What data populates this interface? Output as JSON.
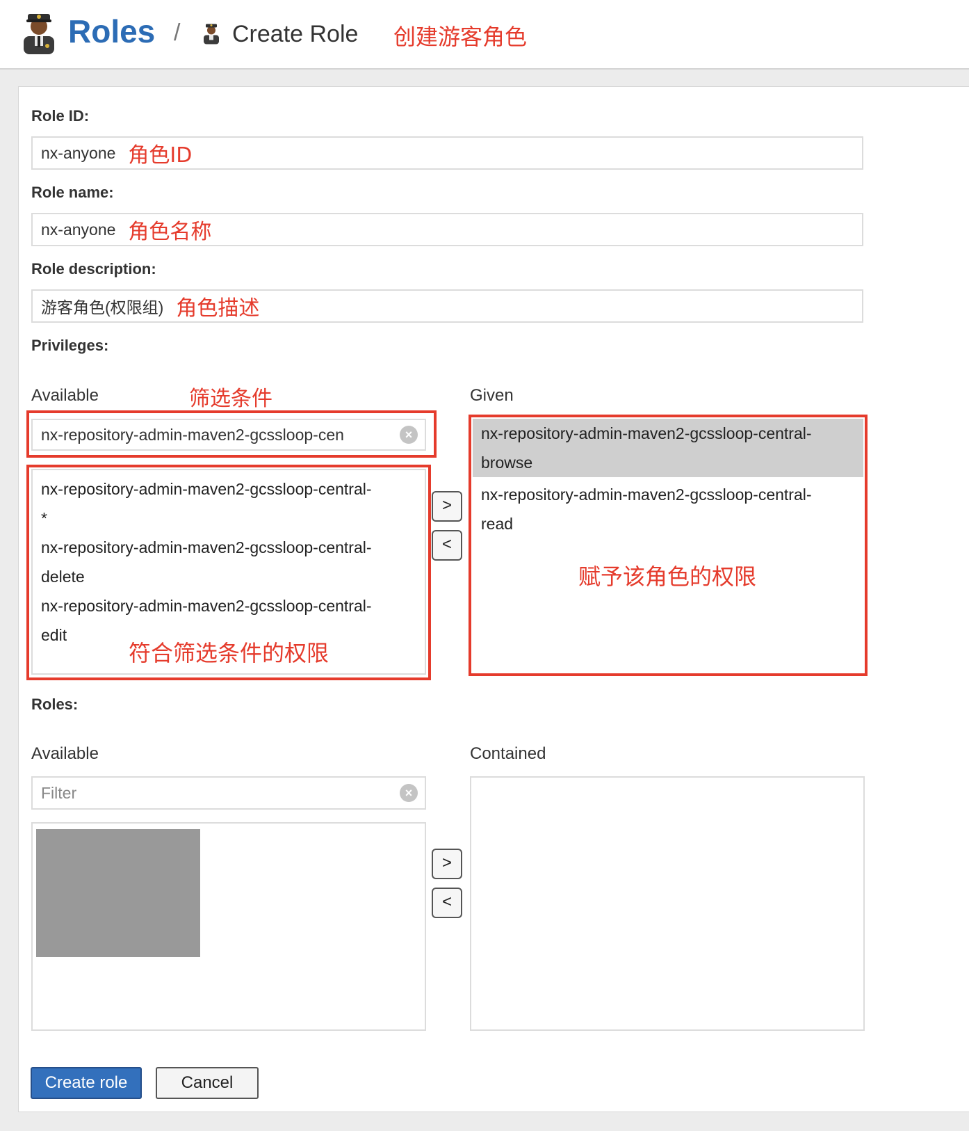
{
  "header": {
    "title": "Roles",
    "separator": "/",
    "subtitle": "Create Role",
    "note": "创建游客角色"
  },
  "form": {
    "role_id": {
      "label": "Role ID:",
      "value": "nx-anyone",
      "note": "角色ID"
    },
    "role_name": {
      "label": "Role name:",
      "value": "nx-anyone",
      "note": "角色名称"
    },
    "role_description": {
      "label": "Role description:",
      "value": "游客角色(权限组)",
      "note": "角色描述"
    }
  },
  "privileges": {
    "label": "Privileges:",
    "available": {
      "label": "Available",
      "filter_value": "nx-repository-admin-maven2-gcssloop-cen",
      "filter_note": "筛选条件",
      "items": [
        "nx-repository-admin-maven2-gcssloop-central-\n*",
        "nx-repository-admin-maven2-gcssloop-central-\ndelete",
        "nx-repository-admin-maven2-gcssloop-central-\nedit"
      ],
      "list_note": "符合筛选条件的权限"
    },
    "given": {
      "label": "Given",
      "items": [
        "nx-repository-admin-maven2-gcssloop-central-\nbrowse",
        "nx-repository-admin-maven2-gcssloop-central-\nread"
      ],
      "selected_index": 0,
      "note": "赋予该角色的权限"
    },
    "move_right": ">",
    "move_left": "<"
  },
  "roles": {
    "label": "Roles:",
    "available": {
      "label": "Available",
      "filter_placeholder": "Filter"
    },
    "contained": {
      "label": "Contained"
    },
    "move_right": ">",
    "move_left": "<"
  },
  "actions": {
    "create_label": "Create role",
    "cancel_label": "Cancel"
  },
  "colors": {
    "accent": "#2c6cb5",
    "primary_button": "#3370bc",
    "annotation": "#e53b2c",
    "selected_row": "#cfcfcf"
  },
  "icons": {
    "header_avatar": "police-officer-icon",
    "crumb_avatar": "police-officer-icon",
    "clear": "clear-circle-icon"
  }
}
